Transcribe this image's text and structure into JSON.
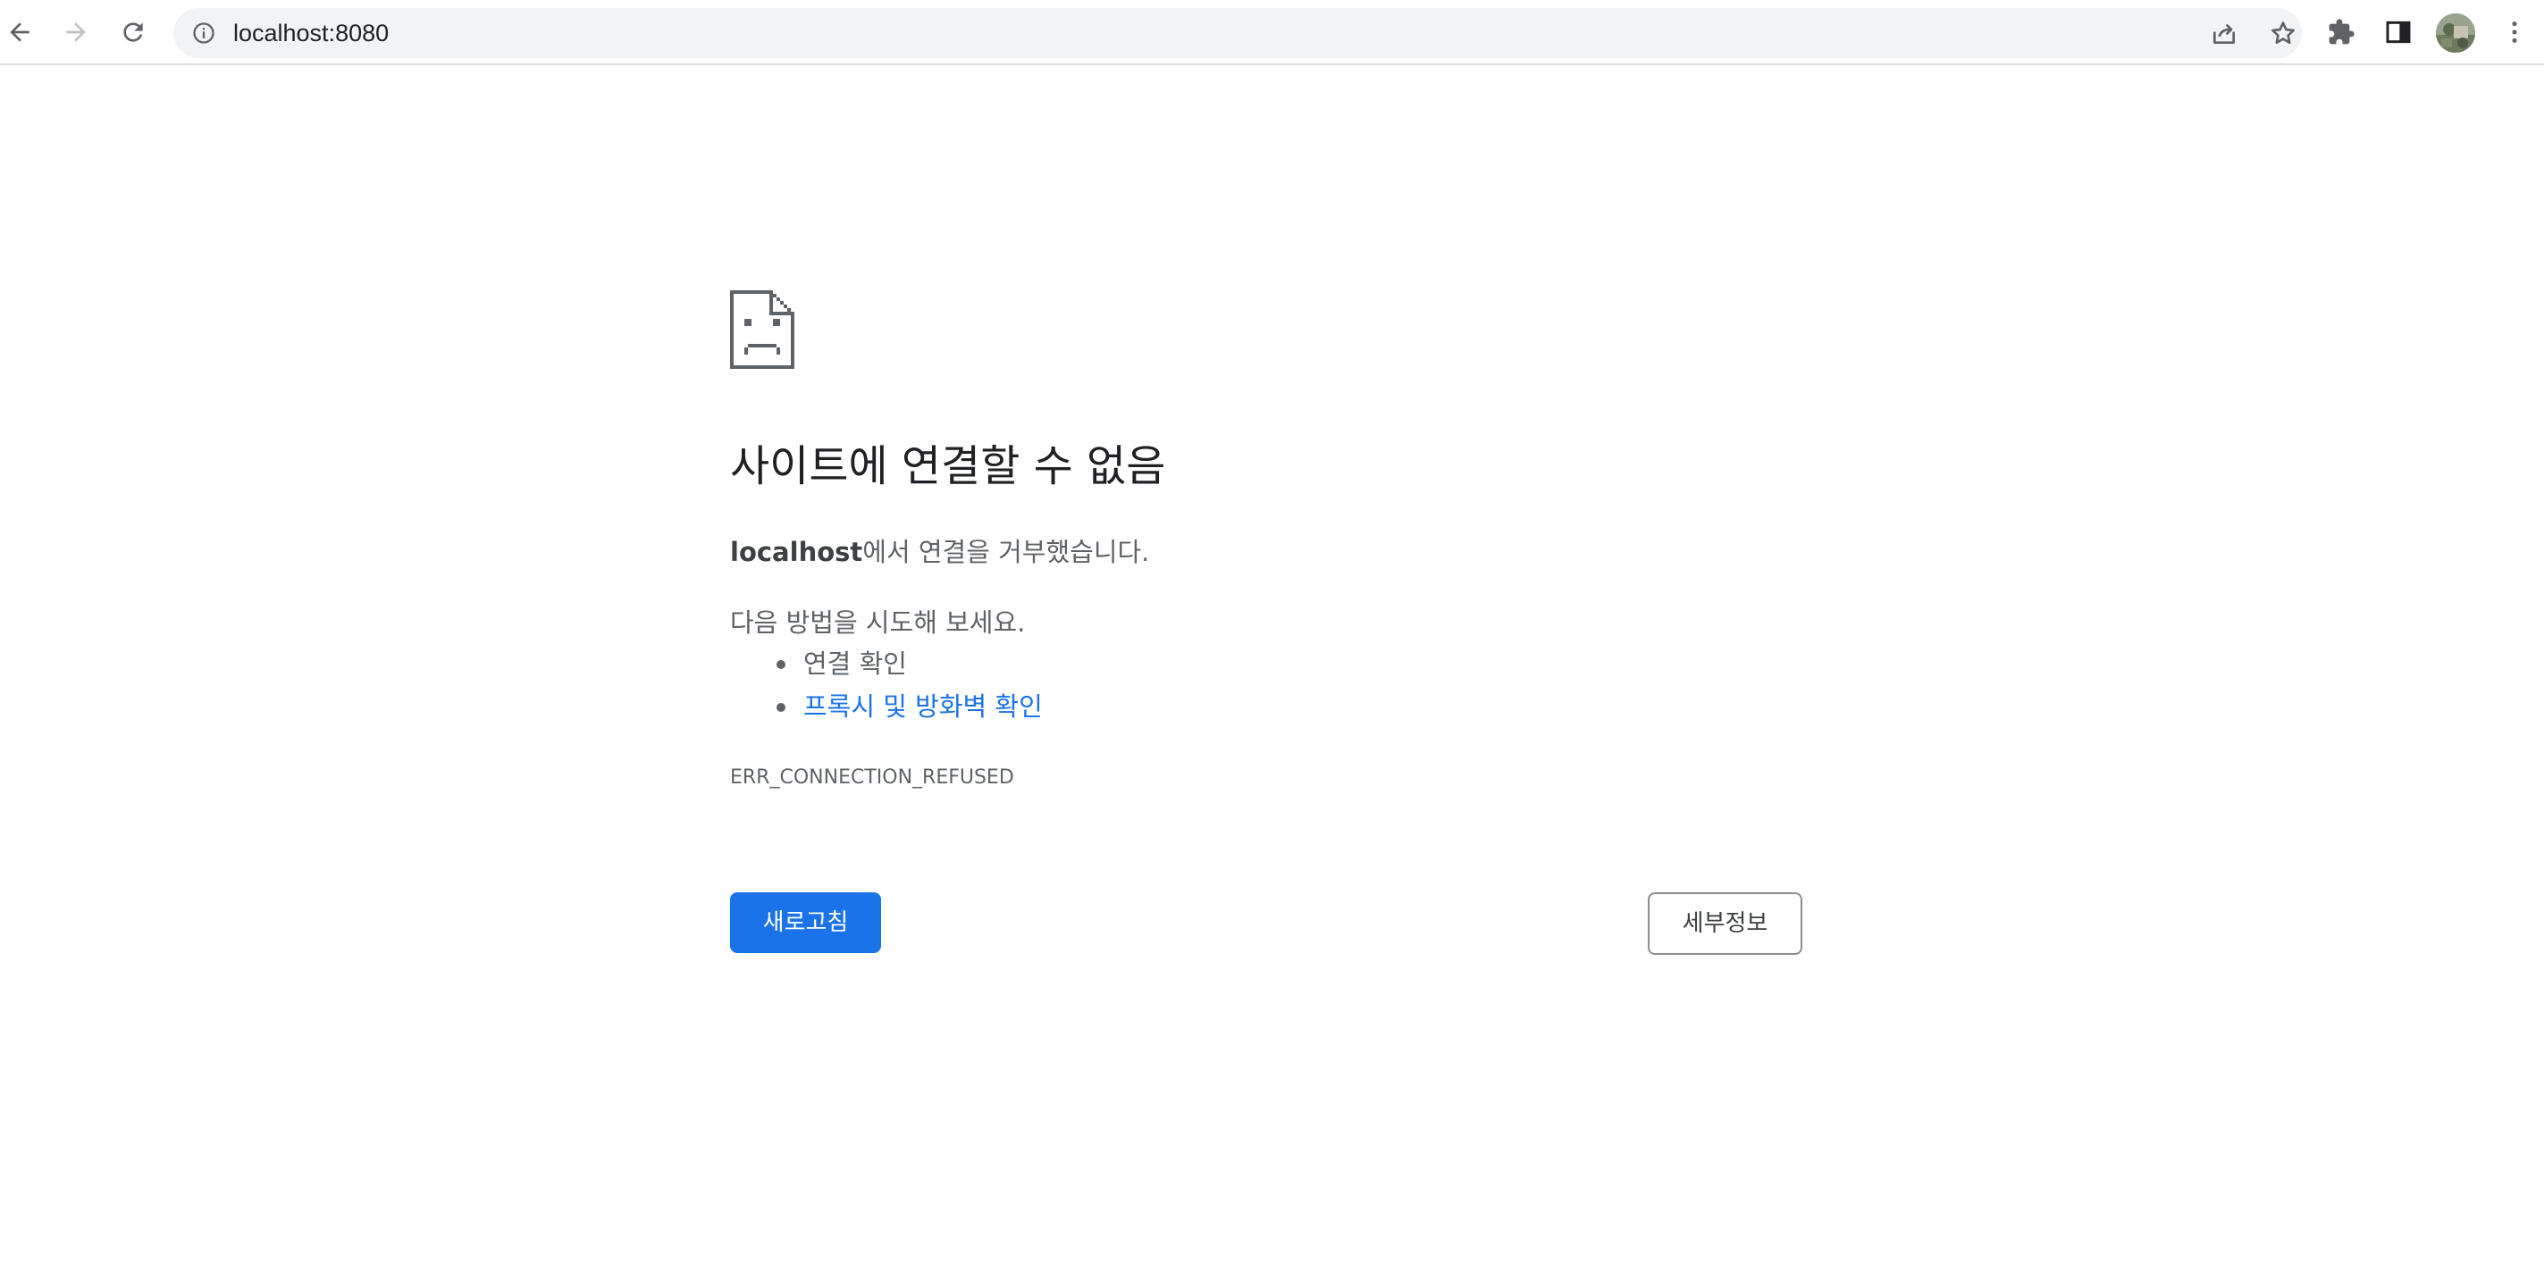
{
  "browser": {
    "url": "localhost:8080",
    "icons": {
      "back": "arrow-left-icon",
      "forward": "arrow-right-icon",
      "reload": "reload-icon",
      "site_info": "info-icon",
      "share": "share-icon",
      "bookmark": "star-icon",
      "extensions": "puzzle-icon",
      "side_panel": "side-panel-icon",
      "profile": "avatar",
      "menu": "kebab-menu-icon"
    },
    "forward_enabled": false
  },
  "error_page": {
    "icon": "sad-document-icon",
    "heading": "사이트에 연결할 수 없음",
    "summary_host": "localhost",
    "summary_text": "에서 연결을 거부했습니다.",
    "suggestions_title": "다음 방법을 시도해 보세요.",
    "suggestions": [
      {
        "label": "연결 확인",
        "is_link": false
      },
      {
        "label": "프록시 및 방화벽 확인",
        "is_link": true
      }
    ],
    "error_code": "ERR_CONNECTION_REFUSED",
    "reload_label": "새로고침",
    "details_label": "세부정보"
  },
  "colors": {
    "accent": "#1a73e8",
    "heading": "#202124",
    "body_text": "#5f6368",
    "omnibox_bg": "#f1f3f4"
  }
}
